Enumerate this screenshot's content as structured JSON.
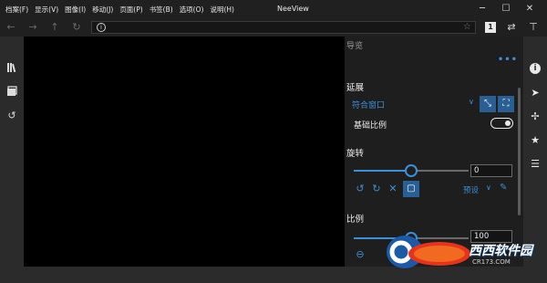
{
  "window": {
    "title": "NeeView",
    "menu": [
      "档案(F)",
      "显示(V)",
      "图像(I)",
      "移动(J)",
      "页面(P)",
      "书签(B)",
      "选项(O)",
      "说明(H)"
    ],
    "minimize_icon": "minimize-icon",
    "maximize_icon": "maximize-icon",
    "close_icon": "close-icon"
  },
  "addressbar": {
    "back_icon": "arrow-left-icon",
    "forward_icon": "arrow-right-icon",
    "up_icon": "arrow-up-icon",
    "refresh_icon": "refresh-icon",
    "address": "",
    "page_mode": "1"
  },
  "left_sidebar": {
    "items": [
      "bookshelf-icon",
      "pages-icon",
      "history-icon"
    ]
  },
  "panel": {
    "title": "导览",
    "more": "•••",
    "stretch": {
      "title": "延展",
      "mode": "符合窗口",
      "base_scale_label": "基础比例",
      "base_scale_on": true
    },
    "rotate": {
      "title": "旋转",
      "value": "0",
      "slider_fraction": 0.5,
      "preset_label": "预设"
    },
    "scale": {
      "title": "比例",
      "value": "100",
      "slider_fraction": 0.5
    }
  },
  "right_bar": {
    "items": [
      "info-icon",
      "navigator-icon",
      "pinwheel-icon",
      "star-icon",
      "playlist-icon"
    ]
  },
  "watermark": {
    "brand": "西西软件园",
    "url": "CR173.COM"
  },
  "colors": {
    "accent": "#3c8fd8",
    "background": "#2b2b2b",
    "panel": "#1e1e1e",
    "viewer": "#000000"
  }
}
